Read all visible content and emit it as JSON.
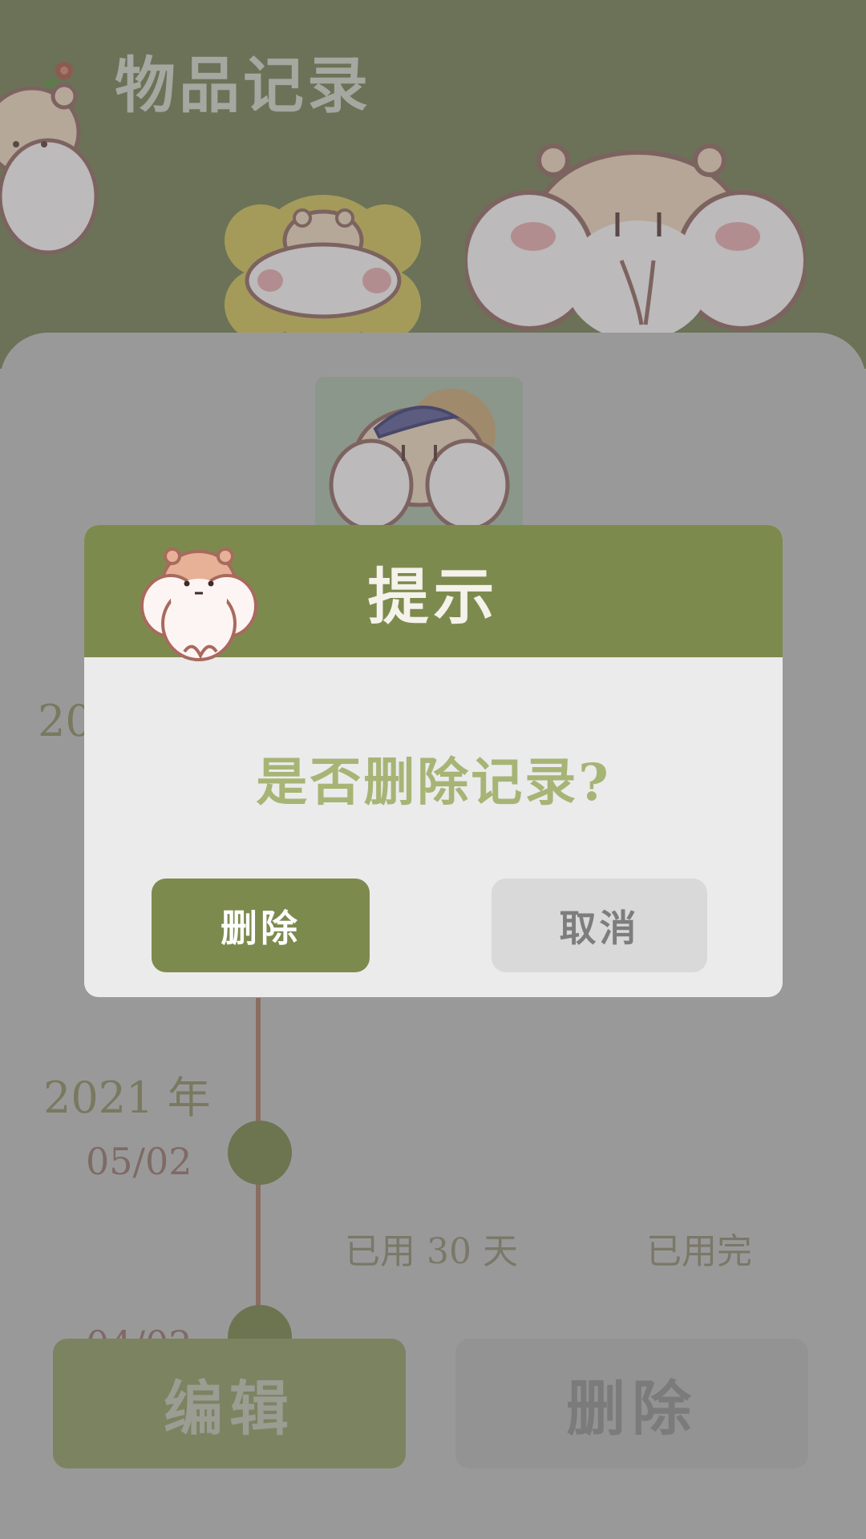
{
  "header": {
    "title": "物品记录"
  },
  "timeline": {
    "partial_year_top": "20",
    "entries": [
      {
        "year": "2021 年",
        "date": "05/02",
        "used_days": "已用 30 天",
        "status": "已用完"
      },
      {
        "date": "04/02"
      }
    ]
  },
  "actions": {
    "edit_label": "编辑",
    "delete_label": "删除"
  },
  "dialog": {
    "title": "提示",
    "message": "是否删除记录?",
    "confirm_label": "删除",
    "cancel_label": "取消"
  },
  "colors": {
    "accent": "#7d8a4e",
    "message": "#a6b475",
    "overlay": "#9a999a"
  },
  "icons": {
    "header_mascots": "hamster-icon",
    "dialog_mascot": "hamster-icon",
    "flower_decoration": "flower-icon"
  }
}
